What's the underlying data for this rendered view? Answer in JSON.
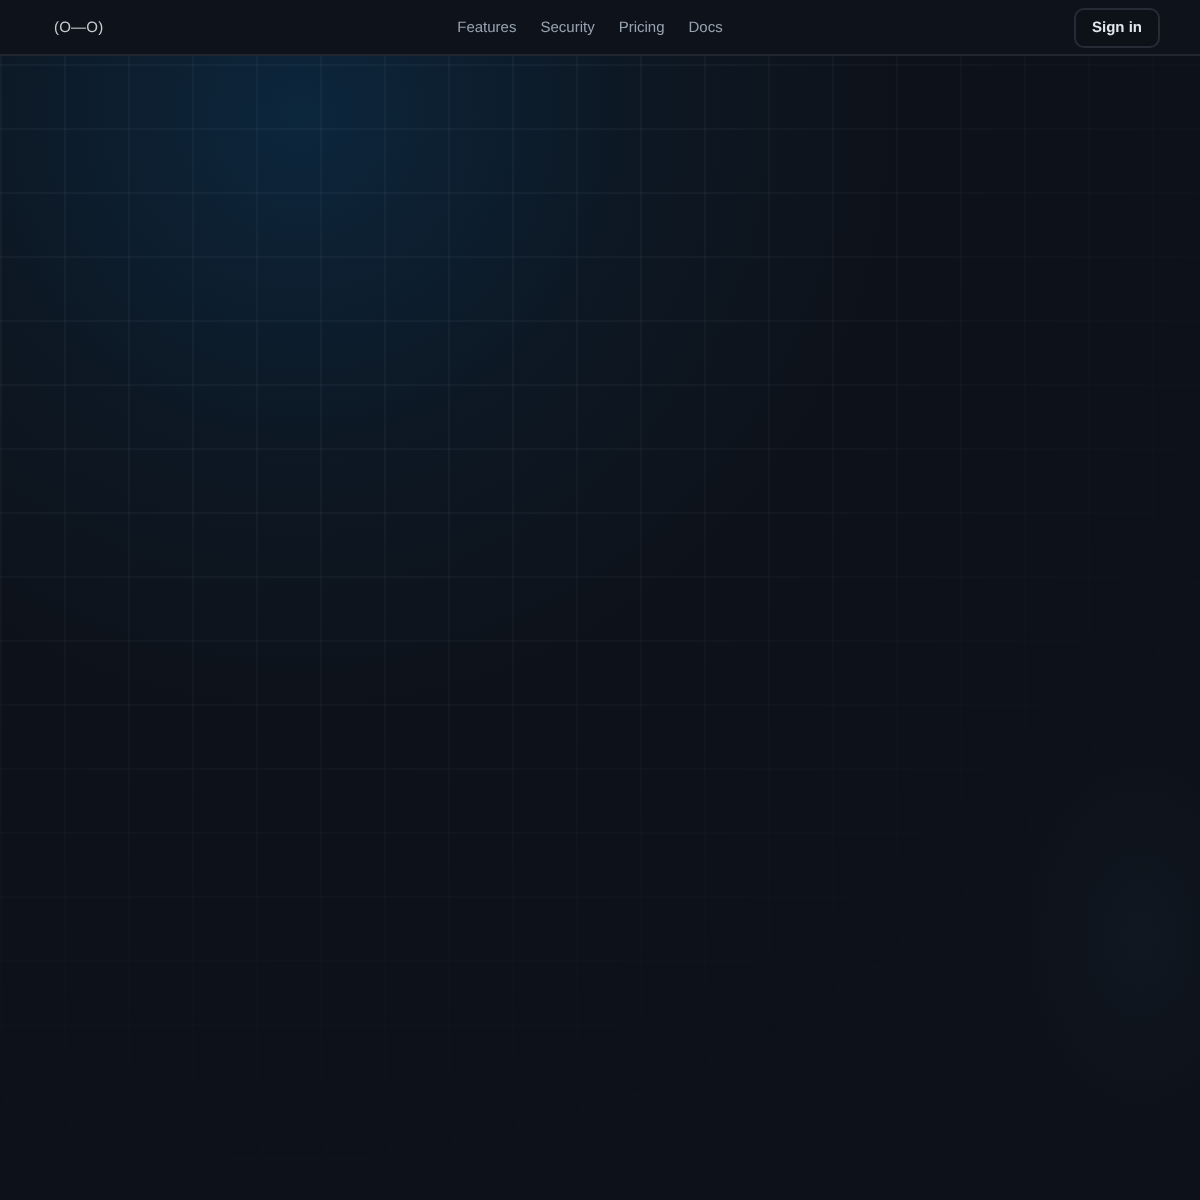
{
  "header": {
    "logo": "(O—O)",
    "nav": [
      {
        "label": "Features"
      },
      {
        "label": "Security"
      },
      {
        "label": "Pricing"
      },
      {
        "label": "Docs"
      }
    ],
    "sign_in": "Sign in"
  }
}
